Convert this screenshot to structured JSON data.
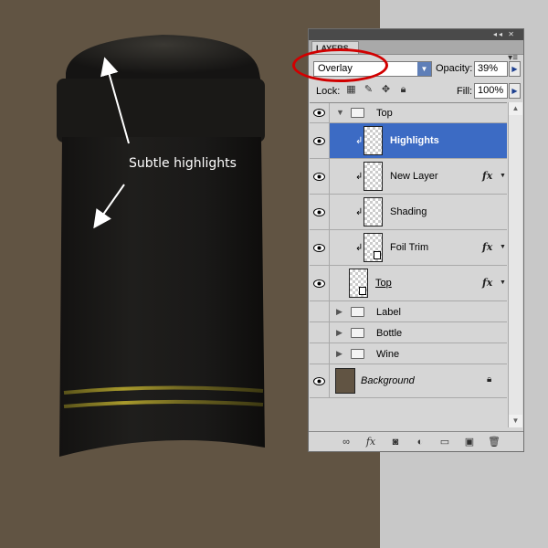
{
  "annotation": {
    "text": "Subtle highlights"
  },
  "panel": {
    "tab_label": "LAYERS",
    "blend_mode": "Overlay",
    "opacity_label": "Opacity:",
    "opacity_value": "39%",
    "lock_label": "Lock:",
    "fill_label": "Fill:",
    "fill_value": "100%",
    "layers": [
      {
        "name": "Top",
        "kind": "group",
        "expanded": true,
        "visible": true
      },
      {
        "name": "Highlights",
        "kind": "layer",
        "selected": true,
        "clipped": true,
        "visible": true
      },
      {
        "name": "New Layer",
        "kind": "layer",
        "clipped": true,
        "fx": true,
        "visible": true
      },
      {
        "name": "Shading",
        "kind": "layer",
        "clipped": true,
        "visible": true
      },
      {
        "name": "Foil Trim",
        "kind": "layer",
        "clipped": true,
        "fx": true,
        "visible": true
      },
      {
        "name": "Top",
        "kind": "layer",
        "fx": true,
        "visible": true
      },
      {
        "name": "Label",
        "kind": "group",
        "visible": false
      },
      {
        "name": "Bottle",
        "kind": "group",
        "visible": false
      },
      {
        "name": "Wine",
        "kind": "group",
        "visible": false
      },
      {
        "name": "Background",
        "kind": "background",
        "locked": true,
        "visible": true
      }
    ],
    "fx_label": "fx",
    "bottom_icons": [
      "link-icon",
      "fx-icon",
      "mask-icon",
      "adjustment-icon",
      "folder-icon",
      "new-layer-icon",
      "trash-icon"
    ]
  },
  "colors": {
    "canvas_bg": "#615443",
    "side_bg": "#c8c8c8",
    "bottle": "#1b1a18",
    "foil_trim": "#9a8f2a",
    "selection": "#3c6bc4",
    "annotation_circle": "#d10000"
  }
}
